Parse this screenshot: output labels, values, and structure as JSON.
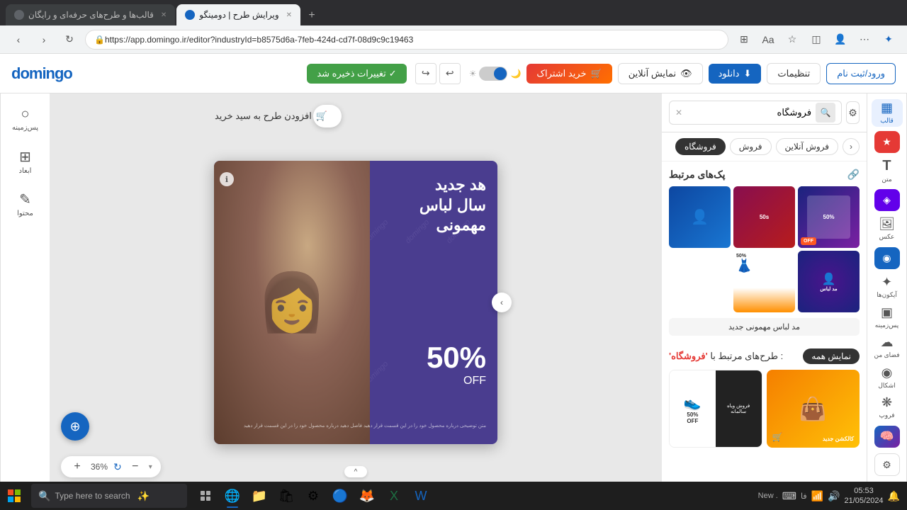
{
  "browser": {
    "tabs": [
      {
        "id": "tab1",
        "label": "قالب‌ها و طرح‌های حرفه‌ای و رایگان",
        "active": false
      },
      {
        "id": "tab2",
        "label": "ویرایش طرح | دومینگو",
        "active": true
      }
    ],
    "url": "https://app.domingo.ir/editor?industryId=b8575d6a-7feb-424d-cd7f-08d9c9c19463",
    "new_tab_label": "+"
  },
  "header": {
    "logo": "domingo",
    "save_btn": "تغییرات ذخیره شد",
    "settings_btn": "تنظیمات",
    "login_btn": "ورود/ثبت نام",
    "show_online_btn": "نمایش آنلاین",
    "download_btn": "دانلود",
    "subscribe_btn": "خرید اشتراک",
    "subscribe_badge": "🛒"
  },
  "tools": {
    "items": [
      {
        "id": "background",
        "label": "پس‌زمینه",
        "icon": "○"
      },
      {
        "id": "dimensions",
        "label": "ابعاد",
        "icon": "⊞"
      },
      {
        "id": "content",
        "label": "محتوا",
        "icon": "✎"
      }
    ]
  },
  "canvas": {
    "zoom": "36%",
    "add_to_cart_btn": "افزودن طرح به سید خرید",
    "design": {
      "title_line1": "هد جدید",
      "title_line2": "سال لباس",
      "title_line3": "مهمونی",
      "percent": "50%",
      "off_text": "OFF",
      "watermark": "domingo"
    }
  },
  "right_panel": {
    "search_placeholder": "فروشگاه",
    "filter_icon": "⚙",
    "categories": [
      {
        "label": "فروشگاه",
        "active": true
      },
      {
        "label": "فروش",
        "active": false
      },
      {
        "label": "فروش آنلاین",
        "active": false
      }
    ],
    "nav_arrow": "‹",
    "related_section": {
      "title": "پک‌های مرتبط",
      "link_icon": "🔗",
      "template_label": "مد لباس مهمونی جدید"
    },
    "related_designs": {
      "header_text": ": طرح‌های مرتبط با",
      "highlight": "'فروشگاه'",
      "show_all_btn": "نمایش همه"
    }
  },
  "right_icons": {
    "items": [
      {
        "id": "template",
        "label": "قالب",
        "icon": "▦",
        "active": true
      },
      {
        "id": "text",
        "label": "متن",
        "icon": "T"
      },
      {
        "id": "photo",
        "label": "عکس",
        "icon": "🖼"
      },
      {
        "id": "icons",
        "label": "آیکون‌ها",
        "icon": "✦"
      },
      {
        "id": "background",
        "label": "پس‌زمینه",
        "icon": "▣"
      },
      {
        "id": "myspace",
        "label": "فضای من",
        "icon": "☁"
      },
      {
        "id": "shapes",
        "label": "اشکال",
        "icon": "◉"
      },
      {
        "id": "fonts",
        "label": "فروپ",
        "icon": "❋"
      }
    ],
    "settings_icon": "⚙"
  },
  "taskbar": {
    "search_text": "Type here to search",
    "time": "05:53",
    "date": "21/05/2024",
    "new_notification": "New ."
  }
}
